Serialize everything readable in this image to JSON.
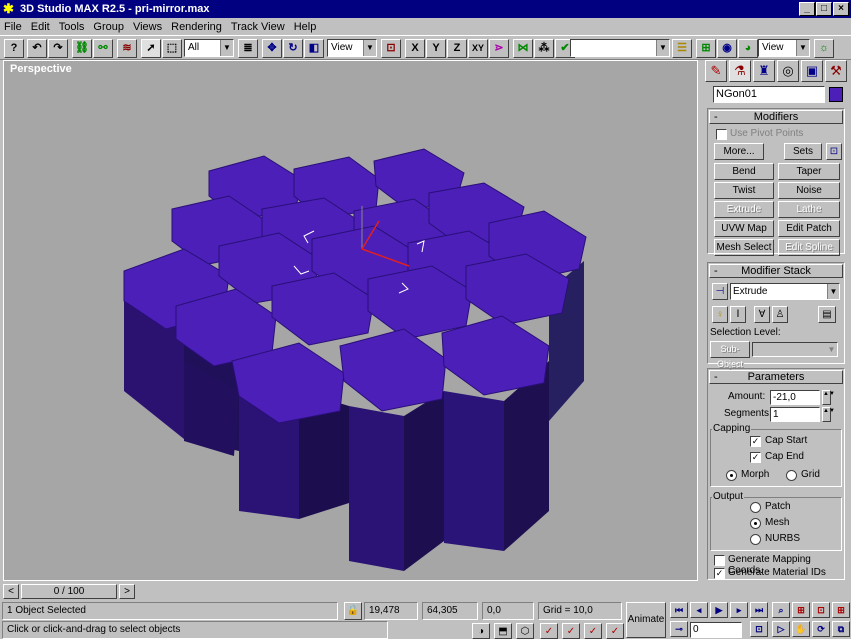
{
  "window": {
    "title": "3D Studio MAX R2.5 - pri-mirror.max",
    "buttons": [
      "_",
      "□",
      "×"
    ]
  },
  "menu": [
    "File",
    "Edit",
    "Tools",
    "Group",
    "Views",
    "Rendering",
    "Track View",
    "Help"
  ],
  "toolbar": {
    "filter_value": "All",
    "coord_value": "View",
    "axis_x": "X",
    "axis_y": "Y",
    "axis_z": "Z",
    "axis_xy": "XY",
    "render_value": "View"
  },
  "viewport": {
    "label": "Perspective",
    "background": "#a6a6a6",
    "object_color": "#4b1fb8"
  },
  "command_panel": {
    "object_name": "NGon01",
    "object_color": "#4b1fb8",
    "modifiers": {
      "title": "Modifiers",
      "use_pivot": "Use Pivot Points",
      "more": "More...",
      "sets": "Sets",
      "buttons": [
        "Bend",
        "Taper",
        "Twist",
        "Noise",
        "Extrude",
        "Lathe",
        "UVW Map",
        "Edit Patch",
        "Mesh Select",
        "Edit Spline"
      ]
    },
    "stack": {
      "title": "Modifier Stack",
      "current": "Extrude",
      "selection_level": "Selection Level:",
      "sub_object": "Sub-Object"
    },
    "parameters": {
      "title": "Parameters",
      "amount_label": "Amount:",
      "amount_value": "-21,0",
      "segments_label": "Segments:",
      "segments_value": "1",
      "capping_label": "Capping",
      "cap_start": "Cap Start",
      "cap_end": "Cap End",
      "morph": "Morph",
      "grid": "Grid",
      "output_label": "Output",
      "patch": "Patch",
      "mesh": "Mesh",
      "nurbs": "NURBS",
      "gen_mapping": "Generate Mapping Coords.",
      "gen_material": "Generate Material IDs"
    }
  },
  "timebar": {
    "frame": "0 / 100",
    "left": "<",
    "right": ">"
  },
  "status": {
    "selected": "1 Object Selected",
    "prompt": "Click or click-and-drag to select objects",
    "x": "19,478",
    "y": "64,305",
    "z": "0,0",
    "grid": "Grid = 10,0",
    "animate": "Animate",
    "frame_field": "0"
  }
}
